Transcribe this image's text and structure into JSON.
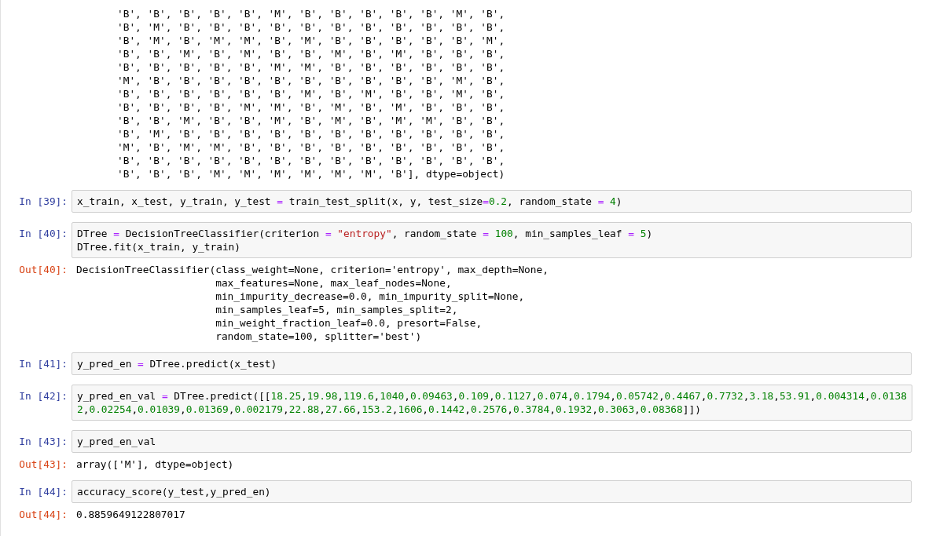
{
  "cells": [
    {
      "output": {
        "lines": [
          "'B', 'B', 'B', 'B', 'B', 'M', 'B', 'B', 'B', 'B', 'B', 'M', 'B',",
          "'B', 'M', 'B', 'B', 'B', 'B', 'B', 'B', 'B', 'B', 'B', 'B', 'B',",
          "'B', 'M', 'B', 'M', 'M', 'B', 'M', 'B', 'B', 'B', 'B', 'B', 'M',",
          "'B', 'B', 'M', 'B', 'M', 'B', 'B', 'M', 'B', 'M', 'B', 'B', 'B',",
          "'B', 'B', 'B', 'B', 'B', 'M', 'M', 'B', 'B', 'B', 'B', 'B', 'B',",
          "'M', 'B', 'B', 'B', 'B', 'B', 'B', 'B', 'B', 'B', 'B', 'M', 'B',",
          "'B', 'B', 'B', 'B', 'B', 'B', 'M', 'B', 'M', 'B', 'B', 'M', 'B',",
          "'B', 'B', 'B', 'B', 'M', 'M', 'B', 'M', 'B', 'M', 'B', 'B', 'B',",
          "'B', 'B', 'M', 'B', 'B', 'M', 'B', 'M', 'B', 'M', 'M', 'B', 'B',",
          "'B', 'M', 'B', 'B', 'B', 'B', 'B', 'B', 'B', 'B', 'B', 'B', 'B',",
          "'M', 'B', 'M', 'M', 'B', 'B', 'B', 'B', 'B', 'B', 'B', 'B', 'B',",
          "'B', 'B', 'B', 'B', 'B', 'B', 'B', 'B', 'B', 'B', 'B', 'B', 'B',",
          "'B', 'B', 'B', 'M', 'M', 'M', 'M', 'M', 'M', 'B'], dtype=object)"
        ]
      }
    },
    {
      "input": {
        "prompt": "In [39]:",
        "lines": [
          "x_train, x_test, y_train, y_test = train_test_split(x, y, test_size=0.2, random_state = 4)"
        ]
      }
    },
    {
      "input": {
        "prompt": "In [40]:",
        "lines": [
          "DTree = DecisionTreeClassifier(criterion = \"entropy\", random_state = 100, min_samples_leaf = 5)",
          "DTree.fit(x_train, y_train)"
        ]
      },
      "output": {
        "prompt": "Out[40]:",
        "lines": [
          "DecisionTreeClassifier(class_weight=None, criterion='entropy', max_depth=None,",
          "                       max_features=None, max_leaf_nodes=None,",
          "                       min_impurity_decrease=0.0, min_impurity_split=None,",
          "                       min_samples_leaf=5, min_samples_split=2,",
          "                       min_weight_fraction_leaf=0.0, presort=False,",
          "                       random_state=100, splitter='best')"
        ]
      }
    },
    {
      "input": {
        "prompt": "In [41]:",
        "lines": [
          "y_pred_en = DTree.predict(x_test)"
        ]
      }
    },
    {
      "input": {
        "prompt": "In [42]:",
        "lines": [
          "y_pred_en_val = DTree.predict([[18.25,19.98,119.6,1040,0.09463,0.109,0.1127,0.074,0.1794,0.05742,0.4467,0.7732,3.18,53.91,0.004314,0.0138",
          "2,0.02254,0.01039,0.01369,0.002179,22.88,27.66,153.2,1606,0.1442,0.2576,0.3784,0.1932,0.3063,0.08368]])"
        ]
      }
    },
    {
      "input": {
        "prompt": "In [43]:",
        "lines": [
          "y_pred_en_val"
        ]
      },
      "output": {
        "prompt": "Out[43]:",
        "lines": [
          "array(['M'], dtype=object)"
        ]
      }
    },
    {
      "input": {
        "prompt": "In [44]:",
        "lines": [
          "accuracy_score(y_test,y_pred_en)"
        ]
      },
      "output": {
        "prompt": "Out[44]:",
        "lines": [
          "0.8859649122807017"
        ]
      }
    }
  ]
}
